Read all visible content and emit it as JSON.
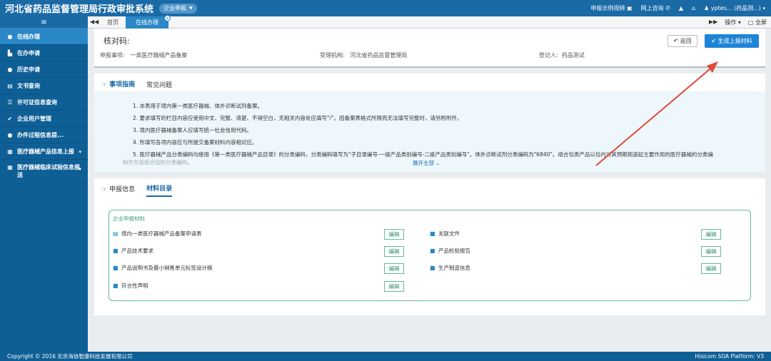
{
  "header": {
    "title": "河北省药品监督管理局行政审批系统",
    "role": "企业申报",
    "links": [
      "申报示例视频",
      "网上咨询"
    ],
    "user": "yptes... (药品测...)"
  },
  "sidebar": {
    "items": [
      {
        "label": "在线办理",
        "icon": "bell-icon"
      },
      {
        "label": "在办申请",
        "icon": "bar-chart-icon"
      },
      {
        "label": "历史申请",
        "icon": "chat-icon"
      },
      {
        "label": "文书查询",
        "icon": "document-icon"
      },
      {
        "label": "许可证信息查询",
        "icon": "list-icon"
      },
      {
        "label": "企业用户管理",
        "icon": "check-circle-icon"
      },
      {
        "label": "办件过程信息提...",
        "icon": "bell-icon"
      },
      {
        "label": "医疗器械产品信息上报",
        "icon": "grid-icon"
      },
      {
        "label": "医疗器械临床试验信息报送",
        "icon": "grid-icon"
      }
    ]
  },
  "tabs": {
    "home": "首页",
    "active": "在线办理",
    "tools": [
      "操作",
      "全屏"
    ]
  },
  "record": {
    "verify_label": "核对码:",
    "item_label": "申报事项:",
    "item_value": "一类医疗器械产品备案",
    "org_label": "受理机构:",
    "org_value": "河北省药品监督管理局",
    "reg_label": "登记人:",
    "reg_value": "药品测试",
    "back_btn": "返回",
    "gen_btn": "生成上报材料"
  },
  "guide": {
    "tab_guide": "事项指南",
    "tab_faq": "常见问题",
    "lines": [
      "1. 本表用于境内第一类医疗器械、体外诊断试剂备案。",
      "2. 要求填写的栏目内容应使用中文、完整、清楚、不得空白，无相关内容处应填写\"/\"。因备案表格式所限而无法填写完整时，请另附附件。",
      "3. 境内医疗器械备案人应填写统一社会信用代码。",
      "4. 所填写各项内容应与所提交备案材料内容相对应。",
      "5. 医疗器械产品分类编码均使用《第一类医疗器械产品目录》的分类编码，分类编码填写为\"子目录编号-一级产品类别编号-二级产品类别编号\"。体外诊断试剂分类编码为\"6840\"。组合包类产品以包内对其预期用途起主要作用的医疗器械的分类编"
    ],
    "fade_line": "码作为该组合包的分类编码。",
    "expand": "展开全部"
  },
  "materials": {
    "tab_info": "申报信息",
    "tab_catalog": "材料目录",
    "legend": "企业申报材料",
    "edit_label": "编辑",
    "left": [
      "境内一类医疗器械产品备案申请表",
      "产品技术要求",
      "产品说明书及最小销售单元标签设计稿",
      "符合性声明"
    ],
    "right": [
      "关联文件",
      "产品检验报告",
      "生产制造信息"
    ]
  },
  "footer": {
    "copyright": "Copyright © 2016 北京海协智康科技发展有限公司",
    "platform": "Hisicom SOA Platform:  V3"
  }
}
